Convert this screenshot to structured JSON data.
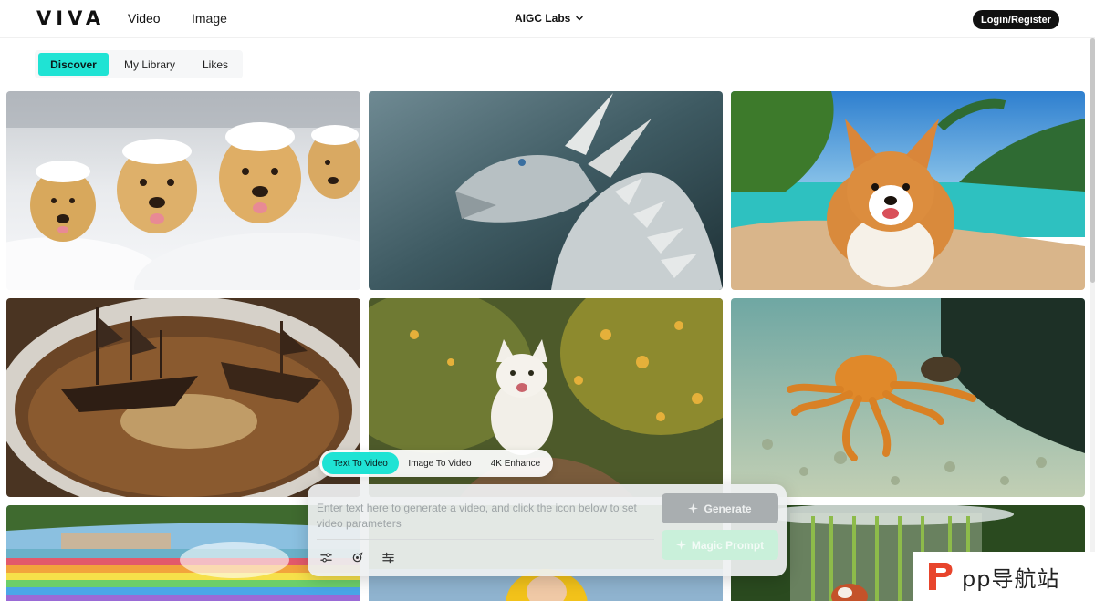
{
  "header": {
    "logo": "VIVA",
    "nav_video": "Video",
    "nav_image": "Image",
    "labs_menu": "AIGC Labs",
    "login": "Login/Register"
  },
  "tabs": [
    "Discover",
    "My Library",
    "Likes"
  ],
  "active_tab": "Discover",
  "gallery": [
    {
      "subject": "golden retriever puppies in snow"
    },
    {
      "subject": "white stone dragon"
    },
    {
      "subject": "corgi on tropical beach"
    },
    {
      "subject": "pirate ships in coffee cup"
    },
    {
      "subject": "white cat on garden path"
    },
    {
      "subject": "orange octopus underwater"
    },
    {
      "subject": "rainbow waterfall"
    },
    {
      "subject": "child in yellow raincoat"
    },
    {
      "subject": "red pandas in bamboo jar"
    }
  ],
  "prompt": {
    "modes": [
      "Text To Video",
      "Image To Video",
      "4K Enhance"
    ],
    "active_mode": "Text To Video",
    "placeholder": "Enter text here to generate a video, and click the icon below to set video parameters",
    "value": "",
    "generate": "Generate",
    "magic_prompt": "Magic Prompt",
    "tools": [
      "settings-sliders-icon",
      "camera-motion-icon",
      "adjust-icon"
    ]
  },
  "watermark": {
    "text": "pp导航站"
  },
  "colors": {
    "accent": "#1fe3d4",
    "login_bg": "#111111",
    "generate_disabled": "#a9aeb0",
    "magic_disabled": "#c9f0da",
    "watermark_red": "#e8452c"
  }
}
